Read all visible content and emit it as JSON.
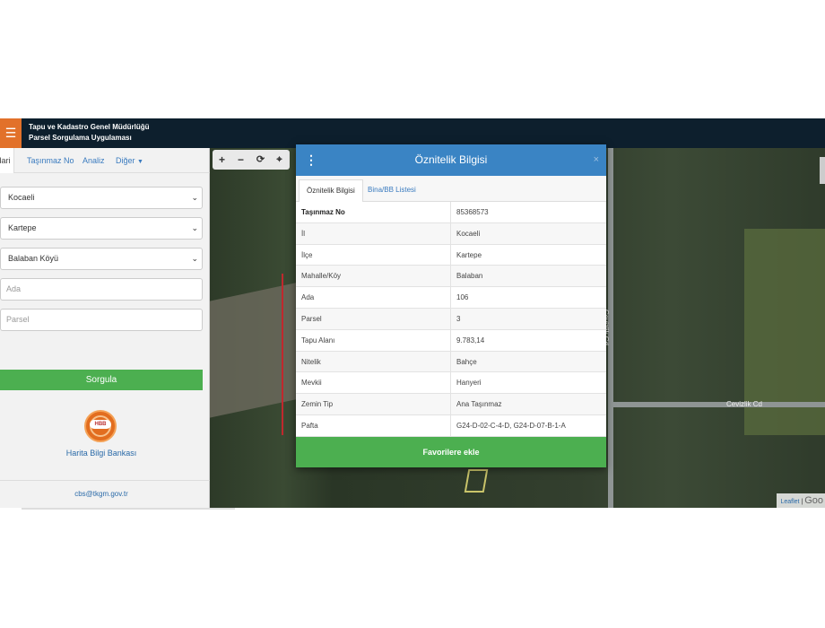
{
  "header": {
    "menu_icon": "hamburger-icon",
    "title_line1": "Tapu ve Kadastro Genel Müdürlüğü",
    "title_line2": "Parsel Sorgulama Uygulaması"
  },
  "sidebar": {
    "tabs": [
      {
        "label": "İdari",
        "active": true
      },
      {
        "label": "Taşınmaz No"
      },
      {
        "label": "Analiz"
      },
      {
        "label": "Diğer",
        "dropdown": true
      }
    ],
    "selects": {
      "il": "Kocaeli",
      "ilce": "Kartepe",
      "mahalle": "Balaban Köyü"
    },
    "inputs": {
      "ada_placeholder": "Ada",
      "parsel_placeholder": "Parsel"
    },
    "query_button": "Sorgula",
    "logo_text": "HBB",
    "logo_name": "Harita Bilgi Bankası",
    "email": "cbs@tkgm.gov.tr"
  },
  "map": {
    "tools": [
      "plus-icon",
      "minus-icon",
      "refresh-icon",
      "locate-icon"
    ],
    "street_vertical": "Cevizlik Cd",
    "street_horizontal": "Cevizlik Cd",
    "attribution": "Leaflet",
    "attribution_google": "Goo"
  },
  "modal": {
    "title": "Öznitelik Bilgisi",
    "close": "×",
    "tabs": [
      {
        "label": "Öznitelik Bilgisi",
        "active": true
      },
      {
        "label": "Bina/BB Listesi"
      }
    ],
    "rows": [
      {
        "key": "Taşınmaz No",
        "value": "85368573"
      },
      {
        "key": "İl",
        "value": "Kocaeli"
      },
      {
        "key": "İlçe",
        "value": "Kartepe"
      },
      {
        "key": "Mahalle/Köy",
        "value": "Balaban"
      },
      {
        "key": "Ada",
        "value": "106"
      },
      {
        "key": "Parsel",
        "value": "3"
      },
      {
        "key": "Tapu Alanı",
        "value": "9.783,14"
      },
      {
        "key": "Nitelik",
        "value": "Bahçe"
      },
      {
        "key": "Mevkii",
        "value": "Hanyeri"
      },
      {
        "key": "Zemin Tip",
        "value": "Ana Taşınmaz"
      },
      {
        "key": "Pafta",
        "value": "G24-D-02-C-4-D, G24-D-07-B-1-A"
      }
    ],
    "favorite_button": "Favorilere ekle"
  },
  "colors": {
    "header_bg": "#0d1f2d",
    "menu_accent": "#e2712a",
    "modal_header": "#3a84c4",
    "primary_green": "#4caf50",
    "link_blue": "#3a7bbf"
  }
}
